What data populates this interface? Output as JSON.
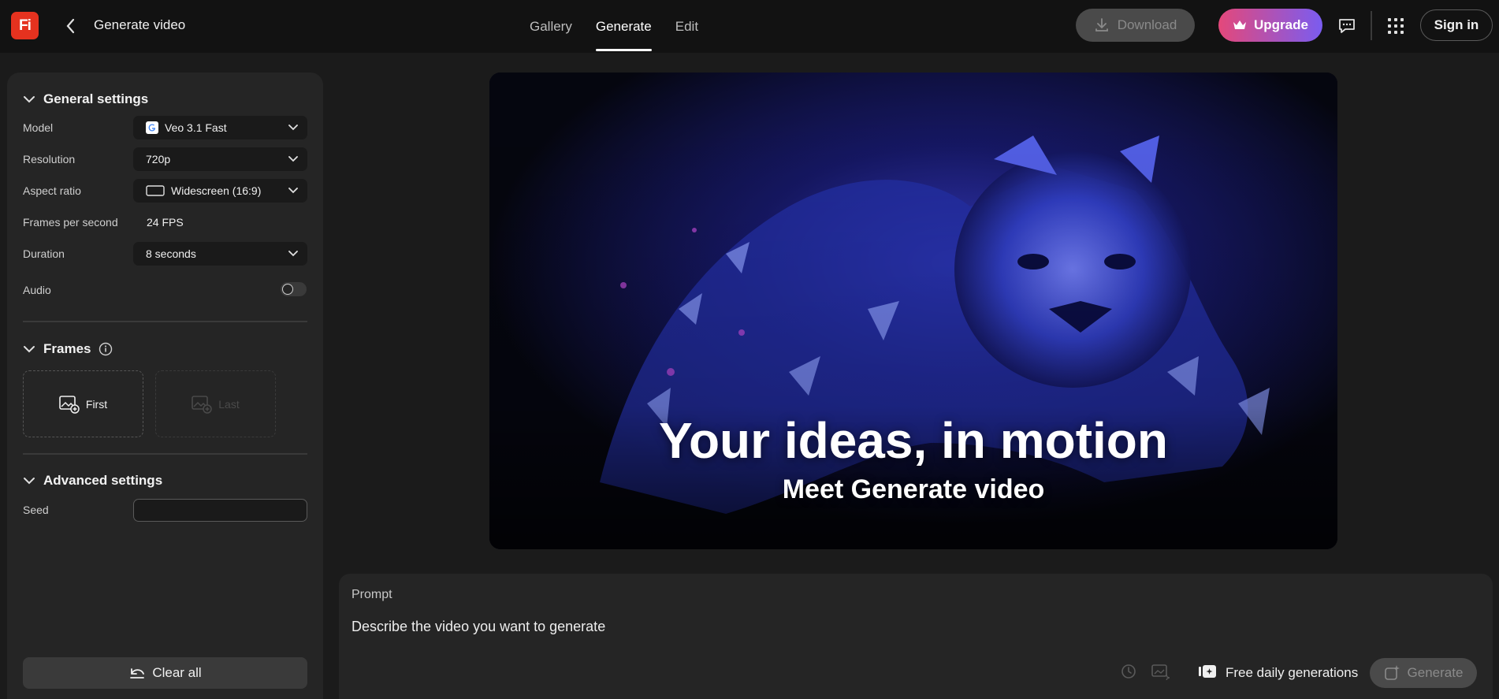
{
  "header": {
    "logo_text": "Fi",
    "title": "Generate video",
    "tabs": [
      {
        "label": "Gallery",
        "active": false
      },
      {
        "label": "Generate",
        "active": true
      },
      {
        "label": "Edit",
        "active": false
      }
    ],
    "download_label": "Download",
    "upgrade_label": "Upgrade",
    "signin_label": "Sign in"
  },
  "sidebar": {
    "general": {
      "title": "General settings",
      "model": {
        "label": "Model",
        "value": "Veo 3.1 Fast"
      },
      "resolution": {
        "label": "Resolution",
        "value": "720p"
      },
      "aspect": {
        "label": "Aspect ratio",
        "value": "Widescreen (16:9)"
      },
      "fps": {
        "label": "Frames per second",
        "value": "24 FPS"
      },
      "duration": {
        "label": "Duration",
        "value": "8 seconds"
      },
      "audio": {
        "label": "Audio",
        "enabled": false
      }
    },
    "frames": {
      "title": "Frames",
      "first_label": "First",
      "last_label": "Last"
    },
    "advanced": {
      "title": "Advanced settings",
      "seed_label": "Seed",
      "seed_value": ""
    },
    "clear_label": "Clear all"
  },
  "preview": {
    "title": "Your ideas, in motion",
    "subtitle": "Meet Generate video"
  },
  "prompt": {
    "label": "Prompt",
    "placeholder": "Describe the video you want to generate",
    "free_label": "Free daily generations",
    "generate_label": "Generate"
  },
  "colors": {
    "background": "#1b1b1b",
    "topbar": "#121212",
    "panel": "#252525",
    "logo": "#e5321f",
    "upgrade_start": "#e4487a",
    "upgrade_end": "#7a5cf0"
  }
}
